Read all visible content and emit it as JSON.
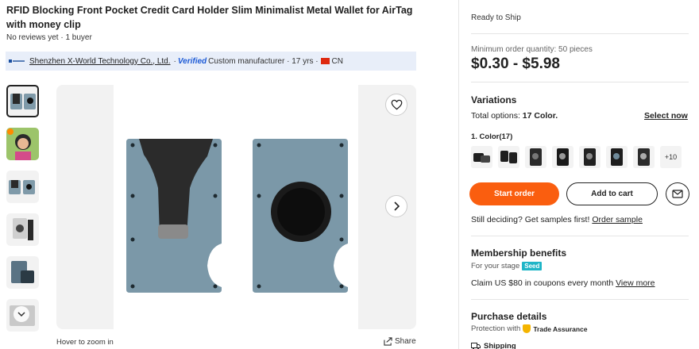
{
  "product": {
    "title": "RFID Blocking Front Pocket Credit Card Holder Slim Minimalist Metal Wallet for AirTag with money clip",
    "reviews": "No reviews yet · 1 buyer"
  },
  "supplier": {
    "name": "Shenzhen X-World Technology Co., Ltd.",
    "separator": "·",
    "verified": "Verified",
    "info": "Custom manufacturer · 17 yrs ·",
    "country": "CN"
  },
  "gallery": {
    "hover_text": "Hover to zoom in",
    "share_label": "Share"
  },
  "order": {
    "ready": "Ready to Ship",
    "moq": "Minimum order quantity: 50 pieces",
    "price": "$0.30 - $5.98"
  },
  "variations": {
    "title": "Variations",
    "total_prefix": "Total options: ",
    "total_value": "17 Color.",
    "select_now": "Select now",
    "color_label": "1. Color(17)",
    "more": "+10"
  },
  "actions": {
    "start_order": "Start order",
    "add_to_cart": "Add to cart"
  },
  "samples": {
    "text": "Still deciding? Get samples first!",
    "link": "Order sample"
  },
  "membership": {
    "title": "Membership benefits",
    "stage": "For your stage",
    "badge": "Seed",
    "coupon_text": "Claim US $80 in coupons every month",
    "view_more": "View more"
  },
  "purchase": {
    "title": "Purchase details",
    "protection": "Protection with",
    "trade_assurance": "Trade Assurance",
    "shipping": "Shipping"
  },
  "colors": {
    "accent": "#fa5e0f",
    "verified": "#1d5bd6",
    "seed": "#1fb5c7"
  }
}
